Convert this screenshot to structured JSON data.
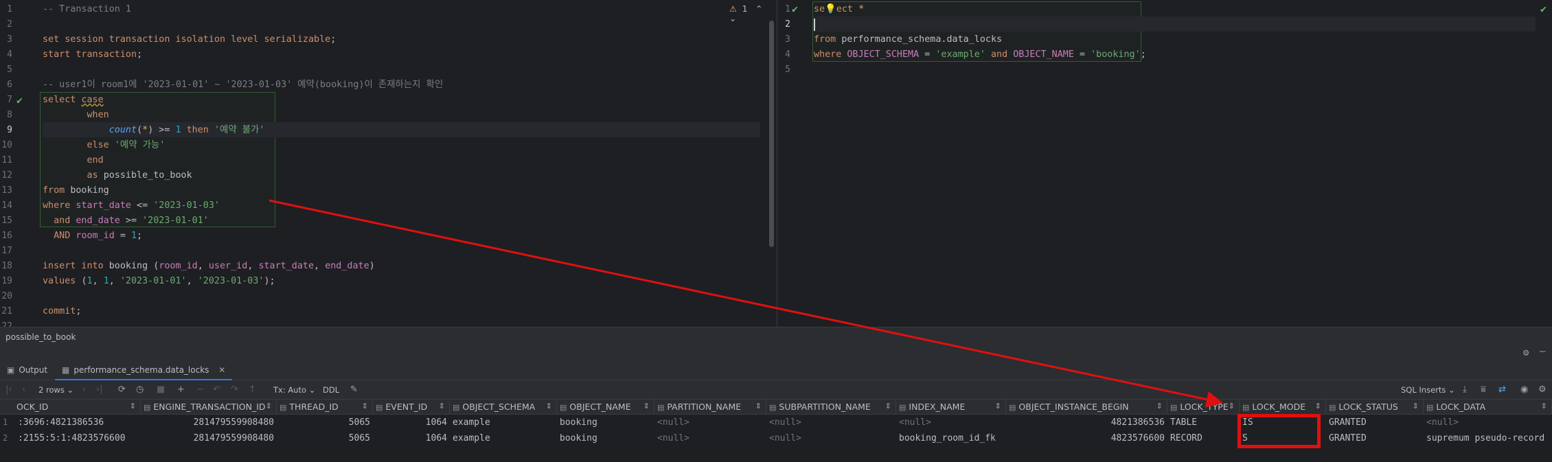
{
  "editor_left": {
    "lines": [
      "-- Transaction 1",
      "",
      "set session transaction isolation level serializable;",
      "start transaction;",
      "",
      "-- user1이 room1에 '2023-01-01' ~ '2023-01-03' 예약(booking)이 존재하는지 확인",
      "select case",
      "when",
      "count(*) >= 1 then '예약 불가'",
      "else '예약 가능'",
      "end",
      "as possible_to_book",
      "from booking",
      "where start_date <= '2023-01-03'",
      "and end_date >= '2023-01-01'",
      "AND room_id = 1;",
      "",
      "insert into booking (room_id, user_id, start_date, end_date)",
      "values (1, 1, '2023-01-01', '2023-01-03');",
      "",
      "commit;",
      ""
    ],
    "warning_count": "1",
    "line_numbers": [
      "1",
      "2",
      "3",
      "4",
      "5",
      "6",
      "7",
      "8",
      "9",
      "10",
      "11",
      "12",
      "13",
      "14",
      "15",
      "16",
      "17",
      "18",
      "19",
      "20",
      "21",
      "22"
    ]
  },
  "editor_right": {
    "line_numbers": [
      "1",
      "2",
      "3",
      "4",
      "5"
    ],
    "lines": [
      "select *",
      "",
      "from performance_schema.data_locks",
      "where OBJECT_SCHEMA = 'example' and OBJECT_NAME = 'booking';",
      ""
    ]
  },
  "result_title": "possible_to_book",
  "tabs": [
    {
      "label": "Output",
      "active": false
    },
    {
      "label": "performance_schema.data_locks",
      "active": true
    }
  ],
  "toolbar": {
    "rows_label": "2 rows",
    "tx_label": "Tx: Auto",
    "ddl_label": "DDL",
    "sql_inserts_label": "SQL Inserts"
  },
  "grid": {
    "columns": [
      "OCK_ID",
      "ENGINE_TRANSACTION_ID",
      "THREAD_ID",
      "EVENT_ID",
      "OBJECT_SCHEMA",
      "OBJECT_NAME",
      "PARTITION_NAME",
      "SUBPARTITION_NAME",
      "INDEX_NAME",
      "OBJECT_INSTANCE_BEGIN",
      "LOCK_TYPE",
      "LOCK_MODE",
      "LOCK_STATUS",
      "LOCK_DATA"
    ],
    "rows": [
      {
        "num": "1",
        "cells": [
          ":3696:4821386536",
          "281479559908480",
          "5065",
          "1064",
          "example",
          "booking",
          "<null>",
          "<null>",
          "<null>",
          "4821386536",
          "TABLE",
          "IS",
          "GRANTED",
          "<null>"
        ]
      },
      {
        "num": "2",
        "cells": [
          ":2155:5:1:4823576600",
          "281479559908480",
          "5065",
          "1064",
          "example",
          "booking",
          "<null>",
          "<null>",
          "booking_room_id_fk",
          "4823576600",
          "RECORD",
          "S",
          "GRANTED",
          "supremum pseudo-record"
        ]
      }
    ]
  },
  "colors": {
    "annotation_red": "#e01010",
    "editor_bg": "#1e1f22",
    "panel_bg": "#2b2d30",
    "keyword": "#cf8e6d",
    "string": "#6aab73",
    "number": "#2aacb8"
  }
}
